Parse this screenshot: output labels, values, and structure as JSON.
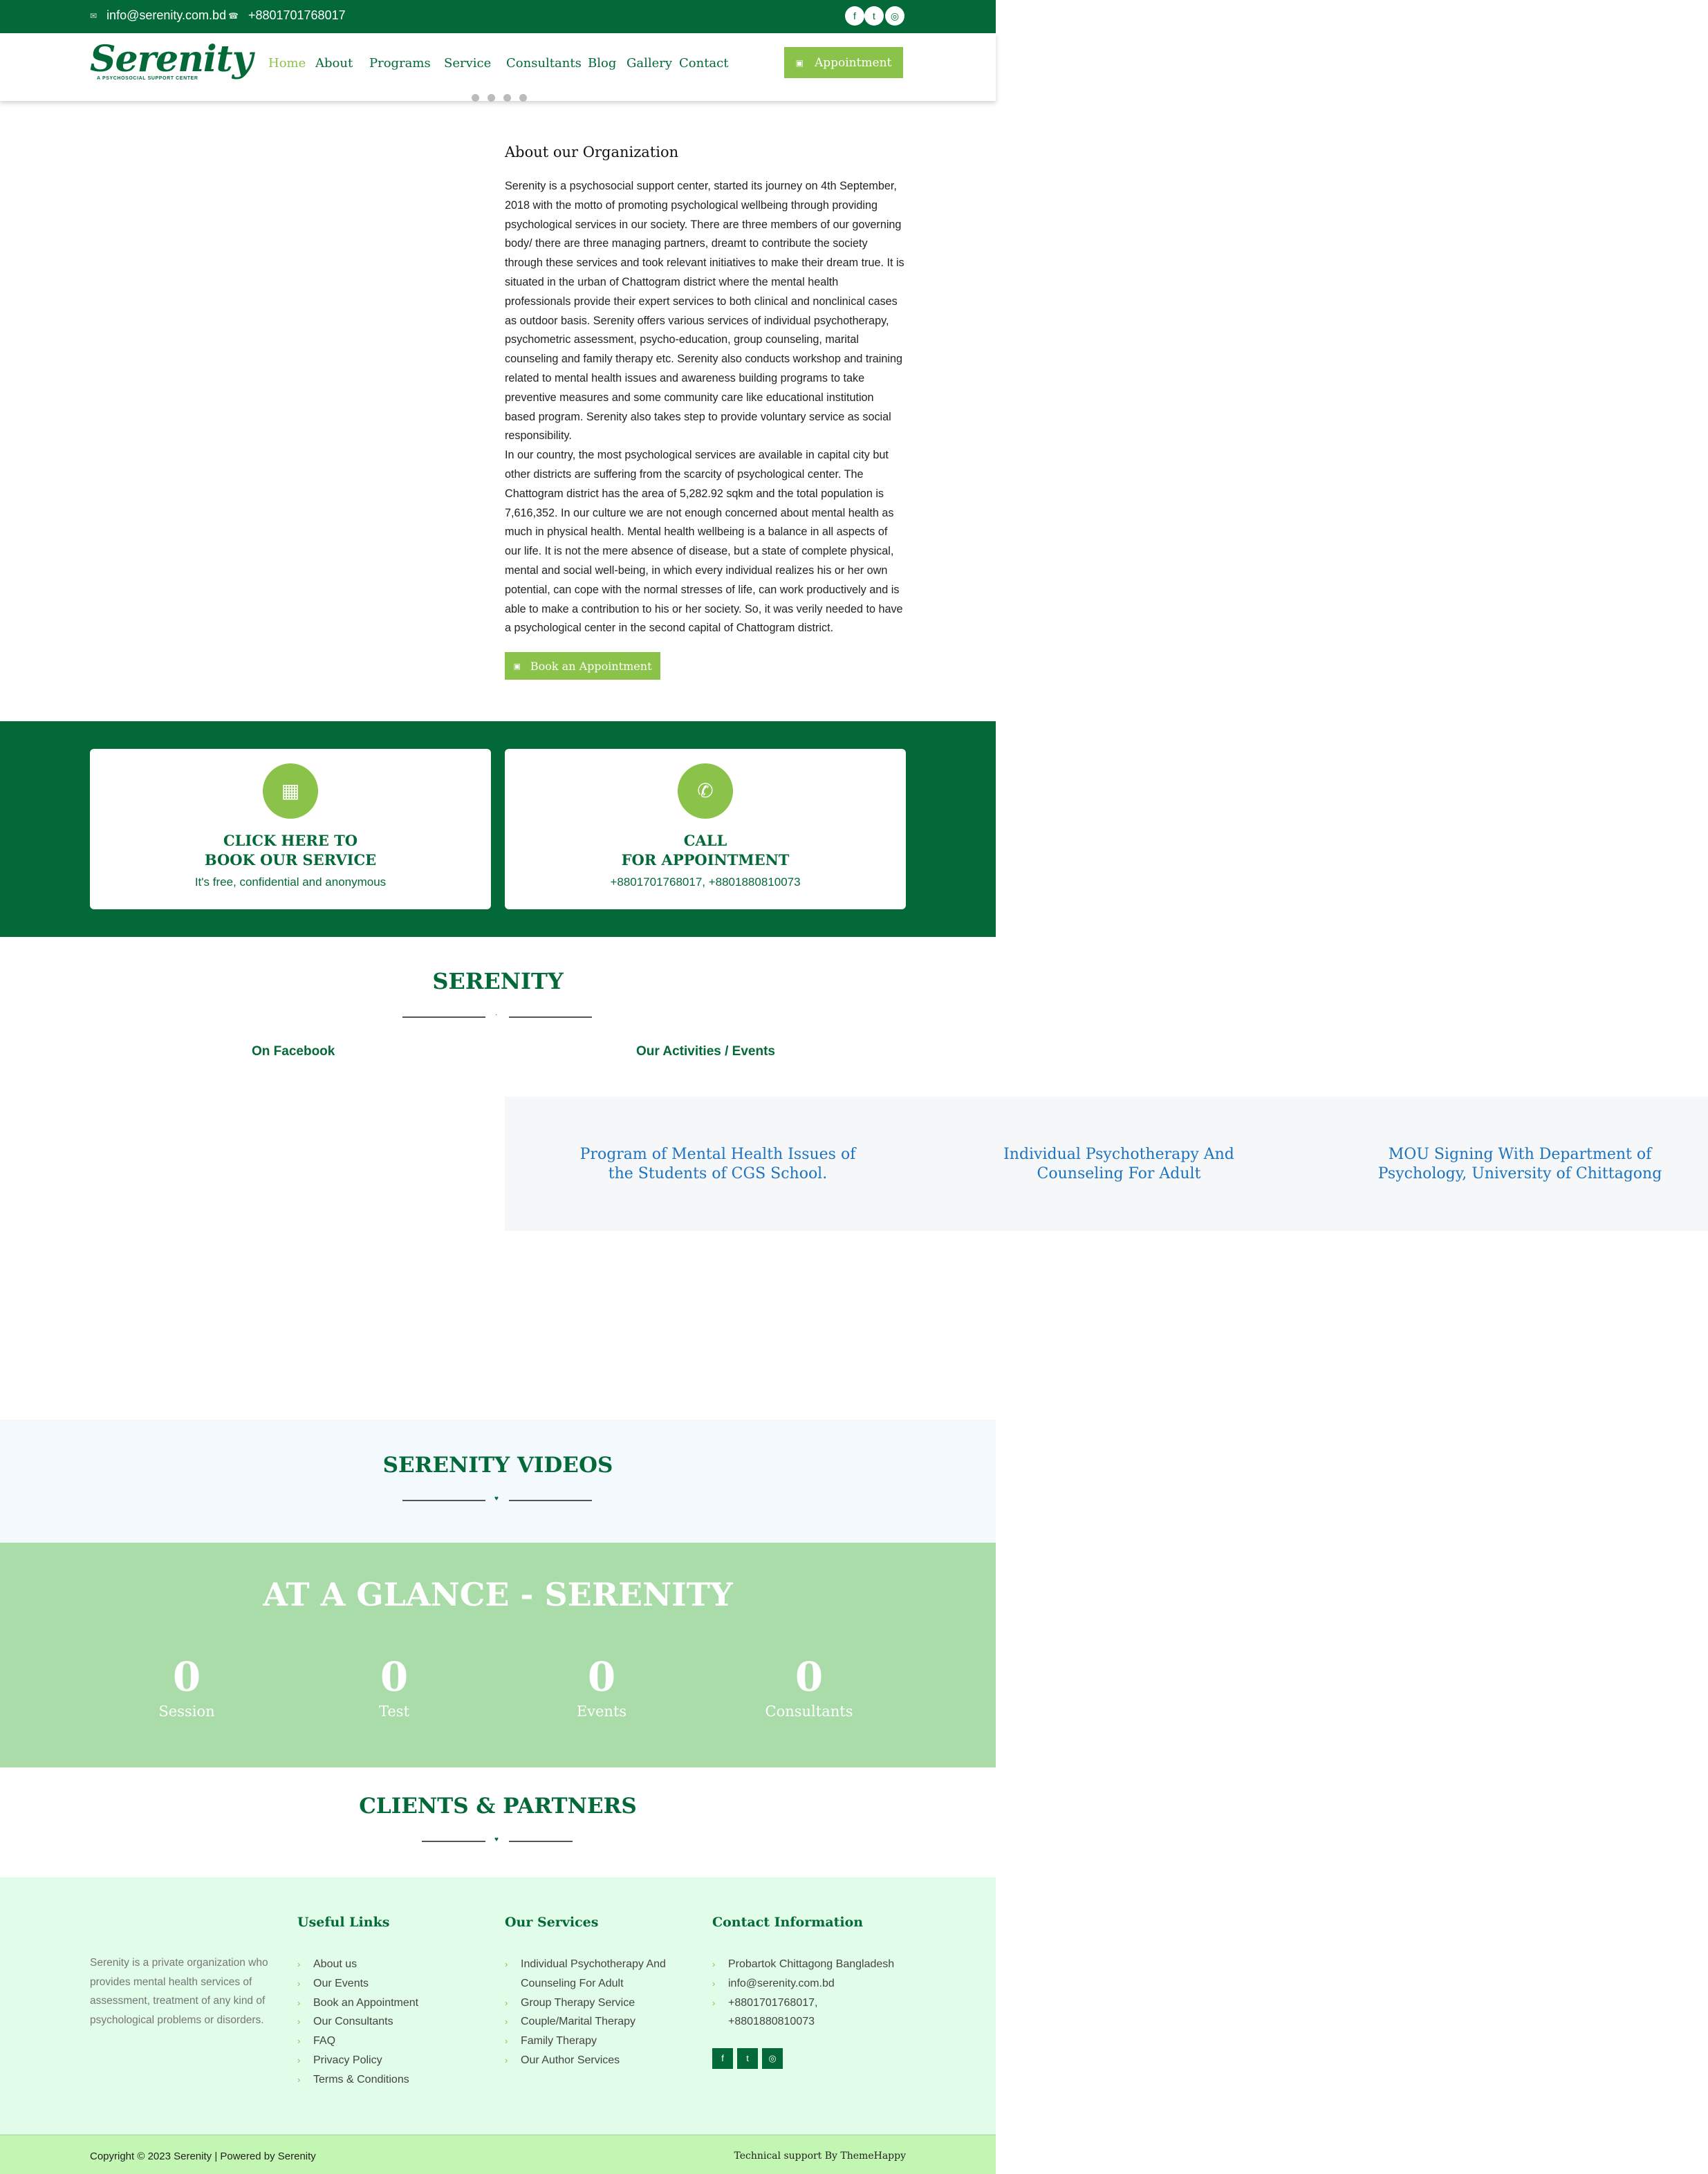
{
  "topbar": {
    "email": "info@serenity.com.bd",
    "phone": "+8801701768017",
    "social_icons": [
      "facebook-icon",
      "twitter-icon",
      "instagram-icon"
    ]
  },
  "header": {
    "logo_word": "Serenity",
    "logo_tagline": "A PSYCHOSOCIAL SUPPORT CENTER",
    "nav": [
      "Home",
      "About",
      "Programs",
      "Service",
      "Consultants",
      "Blog",
      "Gallery",
      "Contact"
    ],
    "active_nav": "Home",
    "appointment_button": "Appointment"
  },
  "about": {
    "title": "About our Organization",
    "paragraphs": [
      "Serenity is a psychosocial support center, started its journey on 4th September, 2018 with the motto of promoting psychological wellbeing through providing psychological services in our society. There are three members of our governing body/ there are three managing partners, dreamt to contribute the society through these services and took relevant initiatives to make their dream true. It is situated in the urban of Chattogram district where the mental health professionals provide their expert services to both clinical and nonclinical cases as outdoor basis. Serenity offers various services of individual psychotherapy, psychometric assessment, psycho-education, group counseling, marital counseling and family therapy etc. Serenity also conducts workshop and training related to mental health issues and awareness building programs to take preventive measures and some community care like educational institution based program. Serenity also takes step to provide voluntary service as social responsibility.",
      "In our country, the most psychological services are available in capital city but other districts are suffering from the scarcity of psychological center. The Chattogram district has the area of 5,282.92 sqkm and the total population is 7,616,352. In our culture we are not enough concerned about mental health as much in physical health. Mental health wellbeing is a balance in all aspects of our life. It is not the mere absence of disease, but a state of complete physical, mental and social well-being, in which every individual realizes his or her own potential, can cope with the normal stresses of life, can work productively and is able to make a contribution to his or her society. So, it was verily needed to have a psychological center in the second capital of Chattogram district."
    ],
    "book_button": "Book an Appointment"
  },
  "cta": {
    "book": {
      "line1": "CLICK HERE TO",
      "line2": "BOOK OUR SERVICE",
      "sub": "It's free, confidential and anonymous"
    },
    "call": {
      "line1": "CALL",
      "line2": "FOR APPOINTMENT",
      "sub": "+8801701768017, +8801880810073"
    }
  },
  "serenity_section": {
    "title": "SERENITY",
    "facebook_label": "On Facebook",
    "events_label": "Our Activities / Events",
    "events": [
      "Program of Mental Health Issues of the Students of CGS School.",
      "Individual Psychotherapy And Counseling For Adult",
      "MOU Signing With Department of Psychology, University of Chittagong"
    ]
  },
  "videos": {
    "title": "SERENITY VIDEOS"
  },
  "glance": {
    "title": "AT A GLANCE - SERENITY",
    "stats": [
      {
        "value": "0",
        "label": "Session"
      },
      {
        "value": "0",
        "label": "Test"
      },
      {
        "value": "0",
        "label": "Events"
      },
      {
        "value": "0",
        "label": "Consultants"
      }
    ]
  },
  "clients": {
    "title": "CLIENTS & PARTNERS"
  },
  "footer": {
    "about": "Serenity is a private organization who provides mental health services of assessment, treatment of any kind of psychological problems or disorders.",
    "useful_links": {
      "title": "Useful Links",
      "items": [
        "About us",
        "Our Events",
        "Book an Appointment",
        "Our Consultants",
        "FAQ",
        "Privacy Policy",
        "Terms & Conditions"
      ]
    },
    "services": {
      "title": "Our Services",
      "items": [
        "Individual Psychotherapy And Counseling For Adult",
        "Group Therapy Service",
        "Couple/Marital Therapy",
        "Family Therapy",
        "Our Author Services"
      ]
    },
    "contact": {
      "title": "Contact Information",
      "address": "Probartok Chittagong Bangladesh",
      "email": "info@serenity.com.bd",
      "phones": "+8801701768017, +8801880810073"
    },
    "copyright": "Copyright © 2023 Serenity | Powered by Serenity",
    "support": "Technical support By ThemeHappy"
  },
  "colors": {
    "primary": "#046938",
    "accent": "#8bc34a",
    "link": "#1e73be",
    "glance_bg": "#a9dca9",
    "footer_bg": "#e1fce8"
  }
}
